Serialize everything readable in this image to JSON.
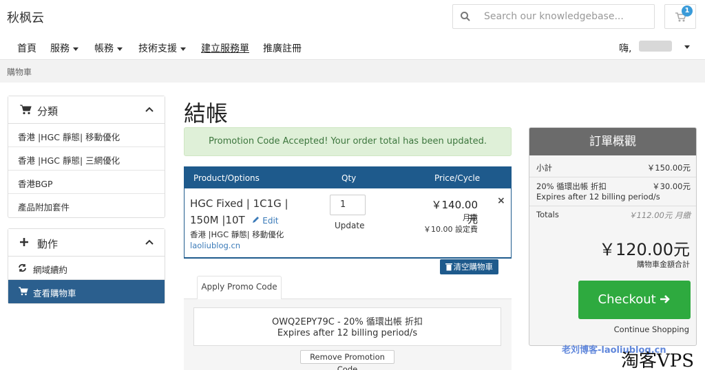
{
  "site": {
    "logo": "秋枫云"
  },
  "search": {
    "placeholder": "Search our knowledgebase..."
  },
  "cart": {
    "badge_count": "1"
  },
  "nav": {
    "items": [
      {
        "label": "首頁"
      },
      {
        "label": "服務"
      },
      {
        "label": "帳務"
      },
      {
        "label": "技術支援"
      },
      {
        "label": "建立服務單"
      },
      {
        "label": "推廣註冊"
      }
    ],
    "greeting": "嗨,"
  },
  "breadcrumb": "購物車",
  "sidebar": {
    "categories": {
      "title": "分類",
      "items": [
        "香港 |HGC 靜態| 移動優化",
        "香港 |HGC 靜態| 三網優化",
        "香港BGP",
        "產品附加套件"
      ]
    },
    "actions": {
      "title": "動作",
      "items": [
        "網域續約",
        "查看購物車"
      ]
    }
  },
  "main": {
    "title": "結帳",
    "alert": "Promotion Code Accepted! Your order total has been updated.",
    "table": {
      "headers": [
        "Product/Options",
        "Qty",
        "Price/Cycle"
      ],
      "product": {
        "name": "HGC Fixed | 1C1G | 150M |10T",
        "edit": "Edit",
        "group": "香港 |HGC 靜態| 移動優化",
        "domain": "laoliublog.cn",
        "qty": "1",
        "update": "Update",
        "price": "￥140.00元",
        "cycle": "月繳",
        "setup": "￥10.00 設定費",
        "remove": "×"
      }
    },
    "empty_cart": "清空購物車",
    "promo": {
      "tab": "Apply Promo Code",
      "line1": "OWQ2EPY79C - 20% 循環出帳 折扣",
      "line2": "Expires after 12 billing period/s",
      "remove": "Remove Promotion Code"
    }
  },
  "summary": {
    "title": "訂單概觀",
    "subtotal_label": "小計",
    "subtotal_value": "￥150.00元",
    "discount_label": "20% 循環出帳 折扣",
    "discount_value": "￥30.00元",
    "discount_note": "Expires after 12 billing period/s",
    "totals_label": "Totals",
    "totals_value": "￥112.00元 月繳",
    "total_big": "￥120.00元",
    "total_caption": "購物車金額合計",
    "checkout": "Checkout",
    "continue": "Continue Shopping"
  },
  "watermarks": {
    "blog": "老刘博客-laoliublog.cn",
    "brand": "淘客VPS"
  }
}
